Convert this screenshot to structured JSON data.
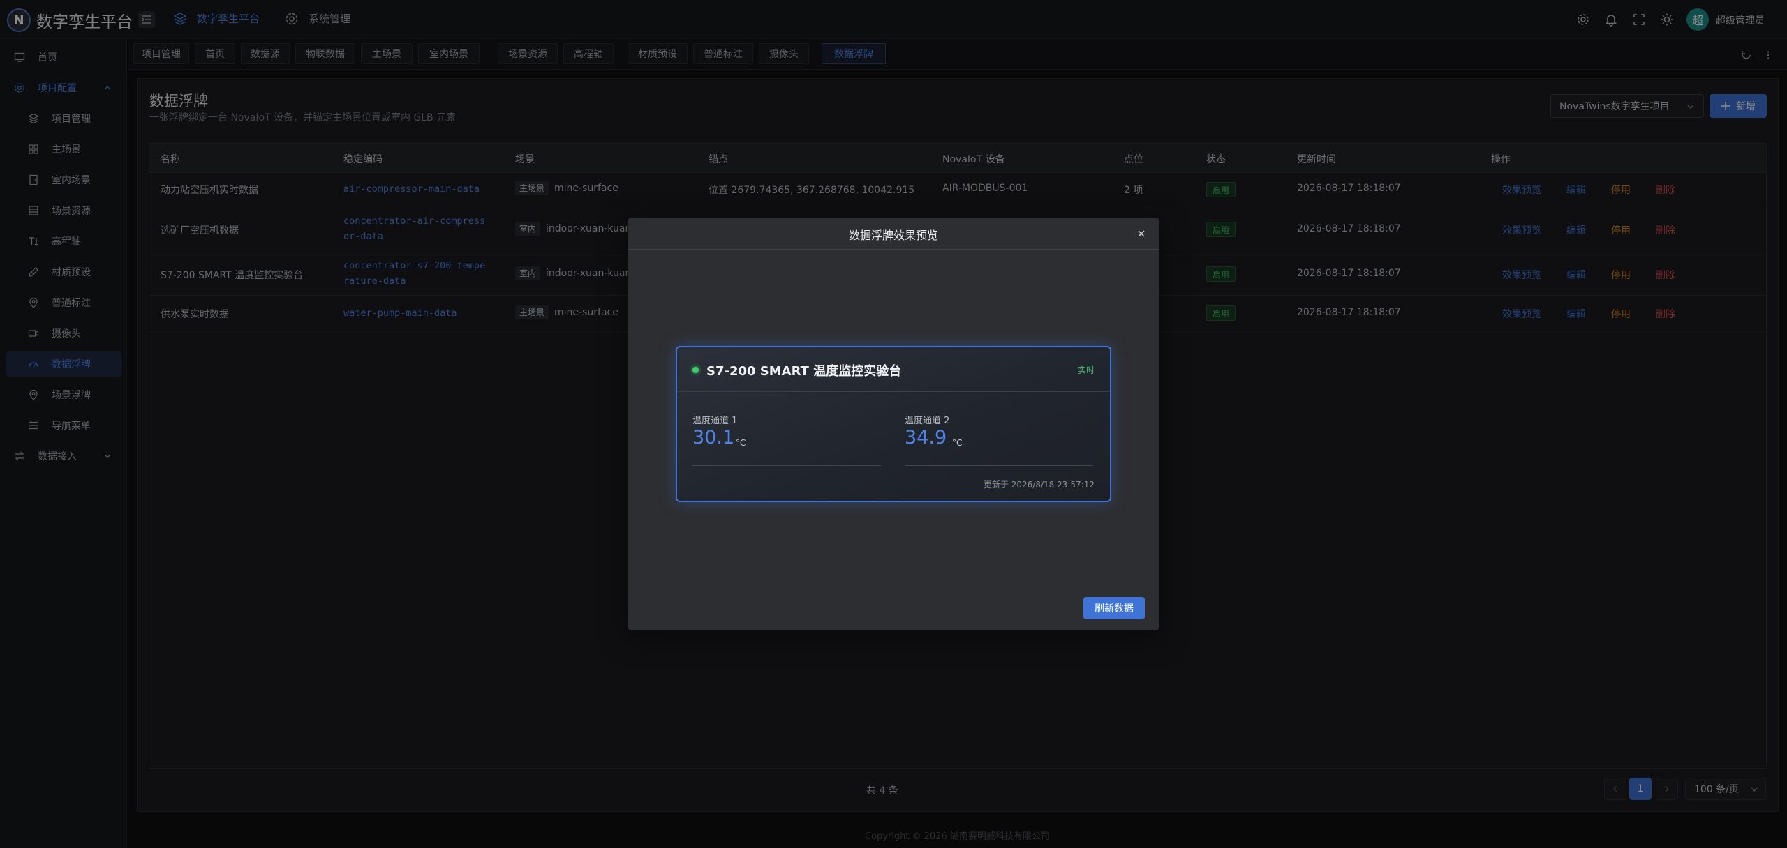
{
  "app": {
    "title": "数字孪生平台",
    "logo_letter": "N"
  },
  "header": {
    "nav": [
      {
        "label": "数字孪生平台",
        "icon": "layers-icon",
        "active": true
      },
      {
        "label": "系统管理",
        "icon": "gear-icon",
        "active": false
      }
    ],
    "tools": [
      "gear-icon",
      "bell-icon",
      "fullscreen-icon",
      "sun-icon"
    ],
    "user": {
      "avatar_text": "超",
      "name": "超级管理员"
    }
  },
  "sidebar": {
    "items": [
      {
        "label": "首页",
        "icon": "monitor-icon",
        "level": "top"
      },
      {
        "label": "项目配置",
        "icon": "gear-icon",
        "level": "top",
        "open": true
      },
      {
        "label": "项目管理",
        "icon": "layers-icon",
        "level": "sub"
      },
      {
        "label": "主场景",
        "icon": "grid-icon",
        "level": "sub"
      },
      {
        "label": "室内场景",
        "icon": "door-icon",
        "level": "sub"
      },
      {
        "label": "场景资源",
        "icon": "database-icon",
        "level": "sub"
      },
      {
        "label": "高程轴",
        "icon": "axis-icon",
        "level": "sub"
      },
      {
        "label": "材质预设",
        "icon": "brush-icon",
        "level": "sub"
      },
      {
        "label": "普通标注",
        "icon": "pin-icon",
        "level": "sub"
      },
      {
        "label": "摄像头",
        "icon": "camera-icon",
        "level": "sub"
      },
      {
        "label": "数据浮牌",
        "icon": "gauge-icon",
        "level": "sub",
        "active": true
      },
      {
        "label": "场景浮牌",
        "icon": "pin-icon",
        "level": "sub"
      },
      {
        "label": "导航菜单",
        "icon": "list-icon",
        "level": "sub"
      },
      {
        "label": "数据接入",
        "icon": "swap-icon",
        "level": "top"
      }
    ]
  },
  "tabs": [
    "项目管理",
    "首页",
    "数据源",
    "物联数据",
    "主场景",
    "室内场景",
    "场景资源",
    "高程轴",
    "材质预设",
    "普通标注",
    "摄像头",
    "数据浮牌"
  ],
  "active_tab": "数据浮牌",
  "page": {
    "title": "数据浮牌",
    "subtitle": "一张浮牌绑定一台 NovaIoT 设备，并锚定主场景位置或室内 GLB 元素",
    "project_select": "NovaTwins数字孪生项目",
    "add_button": "新增"
  },
  "table": {
    "columns": [
      "名称",
      "稳定编码",
      "场景",
      "锚点",
      "NovaIoT 设备",
      "点位",
      "状态",
      "更新时间",
      "操作"
    ],
    "rows": [
      {
        "name": "动力站空压机实时数据",
        "code": [
          "air-compressor-main-data"
        ],
        "scene_tag": "主场景",
        "scene": "mine-surface",
        "anchor": "位置 2679.74365, 367.268768, 10042.915",
        "device": "AIR-MODBUS-001",
        "points": "2 项",
        "status": "启用",
        "updated": "2026-08-17 18:18:07"
      },
      {
        "name": "选矿厂空压机数据",
        "code": [
          "concentrator-air-compress",
          "or-data"
        ],
        "scene_tag": "室内",
        "scene": "indoor-xuan-kuang",
        "anchor": "",
        "device": "",
        "points": "",
        "status": "启用",
        "updated": "2026-08-17 18:18:07"
      },
      {
        "name": "S7-200 SMART 温度监控实验台",
        "code": [
          "concentrator-s7-200-tempe",
          "rature-data"
        ],
        "scene_tag": "室内",
        "scene": "indoor-xuan-kuang",
        "anchor": "",
        "device": "",
        "points": "",
        "status": "启用",
        "updated": "2026-08-17 18:18:07"
      },
      {
        "name": "供水泵实时数据",
        "code": [
          "water-pump-main-data"
        ],
        "scene_tag": "主场景",
        "scene": "mine-surface",
        "anchor": "",
        "device": "",
        "points": "",
        "status": "启用",
        "updated": "2026-08-17 18:18:07"
      }
    ],
    "actions": {
      "preview": "效果预览",
      "edit": "编辑",
      "disable": "停用",
      "delete": "删除"
    }
  },
  "pagination": {
    "total": "共 4 条",
    "current": "1",
    "page_size": "100 条/页"
  },
  "footer": "Copyright © 2026 湖南赛明威科技有限公司",
  "modal": {
    "title": "数据浮牌效果预览",
    "refresh_button": "刷新数据",
    "card": {
      "title": "S7-200 SMART 温度监控实验台",
      "badge": "实时",
      "metrics": [
        {
          "label": "温度通道 1",
          "value": "30.1",
          "unit": "°C"
        },
        {
          "label": "温度通道 2",
          "value": "34.9",
          "unit": "°C"
        }
      ],
      "updated": "更新于 2026/8/18 23:57:12"
    }
  },
  "colors": {
    "accent": "#3f74d6",
    "success": "#46b86a",
    "warning": "#d58a2a",
    "danger": "#d24b4b"
  }
}
